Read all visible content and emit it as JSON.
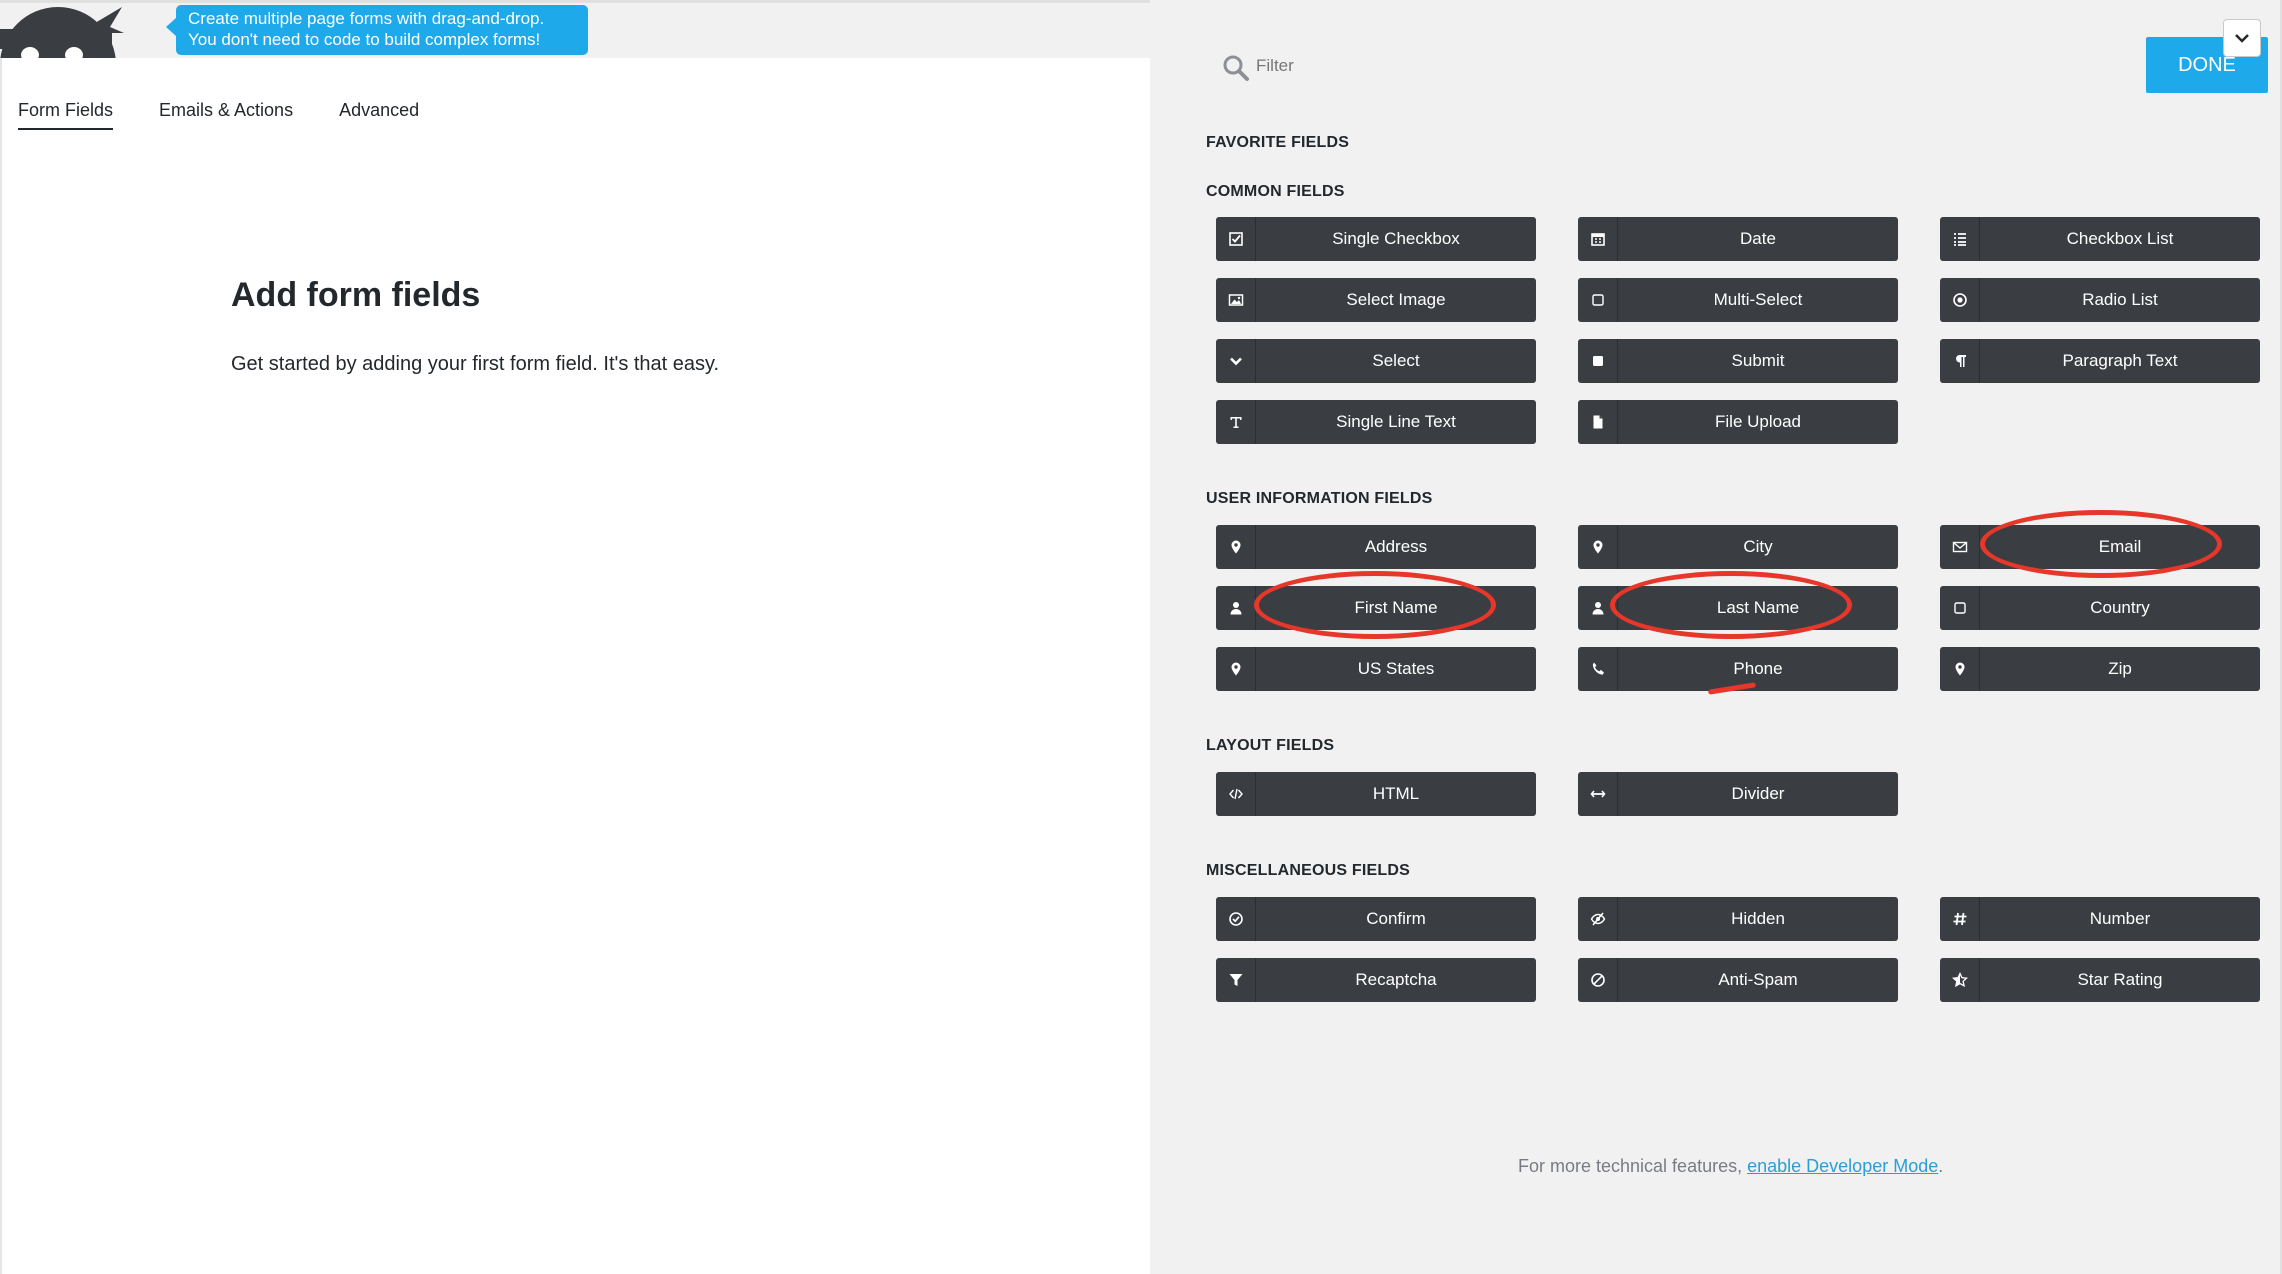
{
  "tooltip": {
    "line1": "Create multiple page forms with drag-and-drop.",
    "line2": "You don't need to code to build complex forms!"
  },
  "tabs": [
    {
      "label": "Form Fields",
      "active": true
    },
    {
      "label": "Emails & Actions",
      "active": false
    },
    {
      "label": "Advanced",
      "active": false
    }
  ],
  "main": {
    "title": "Add form fields",
    "subtitle": "Get started by adding your first form field. It's that easy."
  },
  "drawer": {
    "filter_placeholder": "Filter",
    "done_label": "DONE",
    "sections": {
      "favorite": "FAVORITE FIELDS",
      "common": "COMMON FIELDS",
      "user_info": "USER INFORMATION FIELDS",
      "layout": "LAYOUT FIELDS",
      "misc": "MISCELLANEOUS FIELDS"
    },
    "common_fields": [
      {
        "label": "Single Checkbox",
        "icon": "check-square-icon"
      },
      {
        "label": "Date",
        "icon": "calendar-icon"
      },
      {
        "label": "Checkbox List",
        "icon": "list-icon"
      },
      {
        "label": "Select Image",
        "icon": "image-icon"
      },
      {
        "label": "Multi-Select",
        "icon": "square-outline-icon"
      },
      {
        "label": "Radio List",
        "icon": "radio-icon"
      },
      {
        "label": "Select",
        "icon": "chevron-down-icon"
      },
      {
        "label": "Submit",
        "icon": "square-filled-icon"
      },
      {
        "label": "Paragraph Text",
        "icon": "paragraph-icon"
      },
      {
        "label": "Single Line Text",
        "icon": "text-icon"
      },
      {
        "label": "File Upload",
        "icon": "file-icon"
      }
    ],
    "user_fields": [
      {
        "label": "Address",
        "icon": "map-pin-icon"
      },
      {
        "label": "City",
        "icon": "map-pin-icon"
      },
      {
        "label": "Email",
        "icon": "envelope-icon"
      },
      {
        "label": "First Name",
        "icon": "user-icon"
      },
      {
        "label": "Last Name",
        "icon": "user-icon"
      },
      {
        "label": "Country",
        "icon": "square-outline-icon"
      },
      {
        "label": "US States",
        "icon": "map-pin-icon"
      },
      {
        "label": "Phone",
        "icon": "phone-icon"
      },
      {
        "label": "Zip",
        "icon": "map-pin-icon"
      }
    ],
    "layout_fields": [
      {
        "label": "HTML",
        "icon": "code-icon"
      },
      {
        "label": "Divider",
        "icon": "arrows-horizontal-icon"
      }
    ],
    "misc_fields": [
      {
        "label": "Confirm",
        "icon": "check-circle-icon"
      },
      {
        "label": "Hidden",
        "icon": "eye-slash-icon"
      },
      {
        "label": "Number",
        "icon": "hash-icon"
      },
      {
        "label": "Recaptcha",
        "icon": "filter-icon"
      },
      {
        "label": "Anti-Spam",
        "icon": "ban-icon"
      },
      {
        "label": "Star Rating",
        "icon": "star-icon"
      }
    ],
    "footer": {
      "prefix": "For more technical features, ",
      "link": "enable Developer Mode",
      "suffix": "."
    }
  },
  "colors": {
    "accent": "#1ea9ea",
    "field_button": "#3a3e42",
    "annotation": "#e7362a",
    "link": "#2a9fd6"
  }
}
